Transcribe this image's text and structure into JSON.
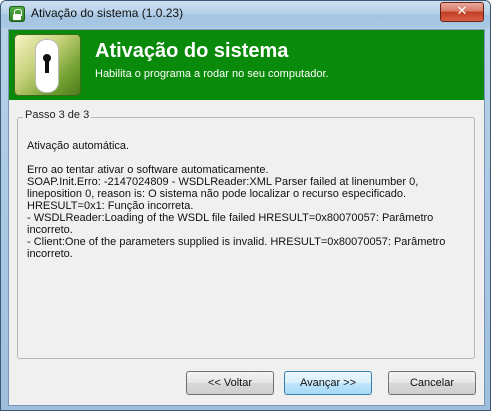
{
  "window": {
    "title": "Ativação do sistema (1.0.23)",
    "close_label": "✕"
  },
  "header": {
    "title": "Ativação do sistema",
    "subtitle": "Habilita o programa a rodar no seu computador.",
    "background_color": "#0a8a0a"
  },
  "step": {
    "label": "Passo 3 de 3"
  },
  "message": {
    "lines": [
      "Ativação automática.",
      "",
      "Erro ao tentar ativar o software automaticamente.",
      "SOAP.Init.Erro: -2147024809 - WSDLReader:XML Parser failed at linenumber 0,",
      "lineposition 0, reason is: O sistema não pode localizar o recurso especificado.",
      "HRESULT=0x1: Função incorreta.",
      "- WSDLReader:Loading of the WSDL file failed HRESULT=0x80070057: Parâmetro",
      "incorreto.",
      "- Client:One of the parameters supplied is invalid. HRESULT=0x80070057: Parâmetro",
      "incorreto."
    ]
  },
  "buttons": {
    "back": "<< Voltar",
    "next": "Avançar >>",
    "cancel": "Cancelar"
  }
}
